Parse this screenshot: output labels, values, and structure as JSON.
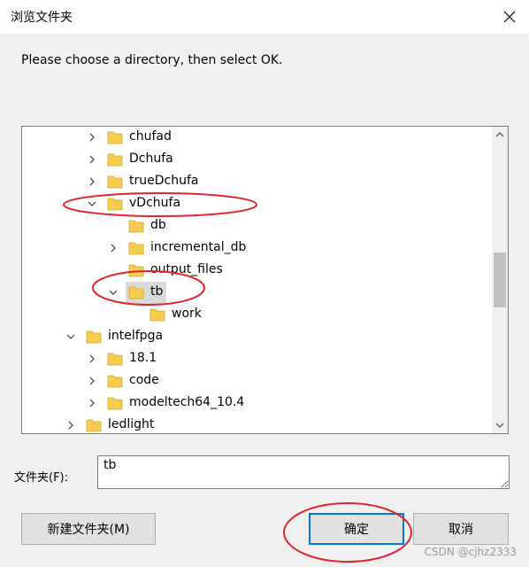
{
  "window": {
    "title": "浏览文件夹"
  },
  "instruction": "Please choose a directory, then select OK.",
  "tree": {
    "items": [
      {
        "label": "chufad",
        "chevron": "right"
      },
      {
        "label": "Dchufa",
        "chevron": "right"
      },
      {
        "label": "trueDchufa",
        "chevron": "right"
      },
      {
        "label": "vDchufa",
        "chevron": "down"
      },
      {
        "label": "db",
        "chevron": ""
      },
      {
        "label": "incremental_db",
        "chevron": "right"
      },
      {
        "label": "output_files",
        "chevron": ""
      },
      {
        "label": "tb",
        "chevron": "down",
        "selected": true
      },
      {
        "label": "work",
        "chevron": ""
      },
      {
        "label": "intelfpga",
        "chevron": "down"
      },
      {
        "label": "18.1",
        "chevron": "right"
      },
      {
        "label": "code",
        "chevron": "right"
      },
      {
        "label": "modeltech64_10.4",
        "chevron": "right"
      },
      {
        "label": "ledlight",
        "chevron": "right"
      }
    ]
  },
  "folder_field": {
    "label": "文件夹(F):",
    "value": "tb"
  },
  "buttons": {
    "new_folder": "新建文件夹(M)",
    "ok": "确定",
    "cancel": "取消"
  },
  "watermark": "CSDN @cjhz2333",
  "colors": {
    "folder": "#f5cc4f",
    "annotation": "#e3242b",
    "focus": "#0078d7"
  }
}
